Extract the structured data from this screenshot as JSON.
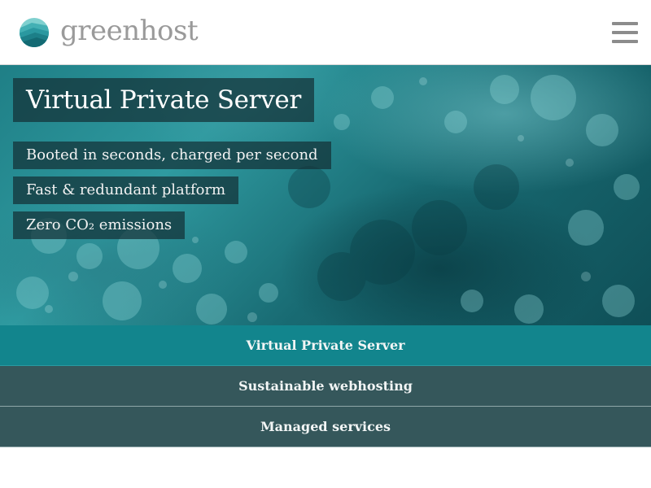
{
  "header": {
    "logo_text": "greenhost",
    "logo_icon": "greenhost-logo-icon",
    "menu_icon": "hamburger-menu-icon"
  },
  "hero": {
    "title": "Virtual Private Server",
    "features": [
      "Booted in seconds, charged per second",
      "Fast & redundant platform",
      "Zero CO₂ emissions"
    ]
  },
  "service_nav": {
    "items": [
      {
        "label": "Virtual Private Server",
        "active": true
      },
      {
        "label": "Sustainable webhosting",
        "active": false
      },
      {
        "label": "Managed services",
        "active": false
      }
    ]
  },
  "colors": {
    "brand_teal": "#12858d",
    "nav_inactive": "#35575b",
    "logo_text": "#9a9a9a",
    "hero_overlay": "#14303b"
  }
}
